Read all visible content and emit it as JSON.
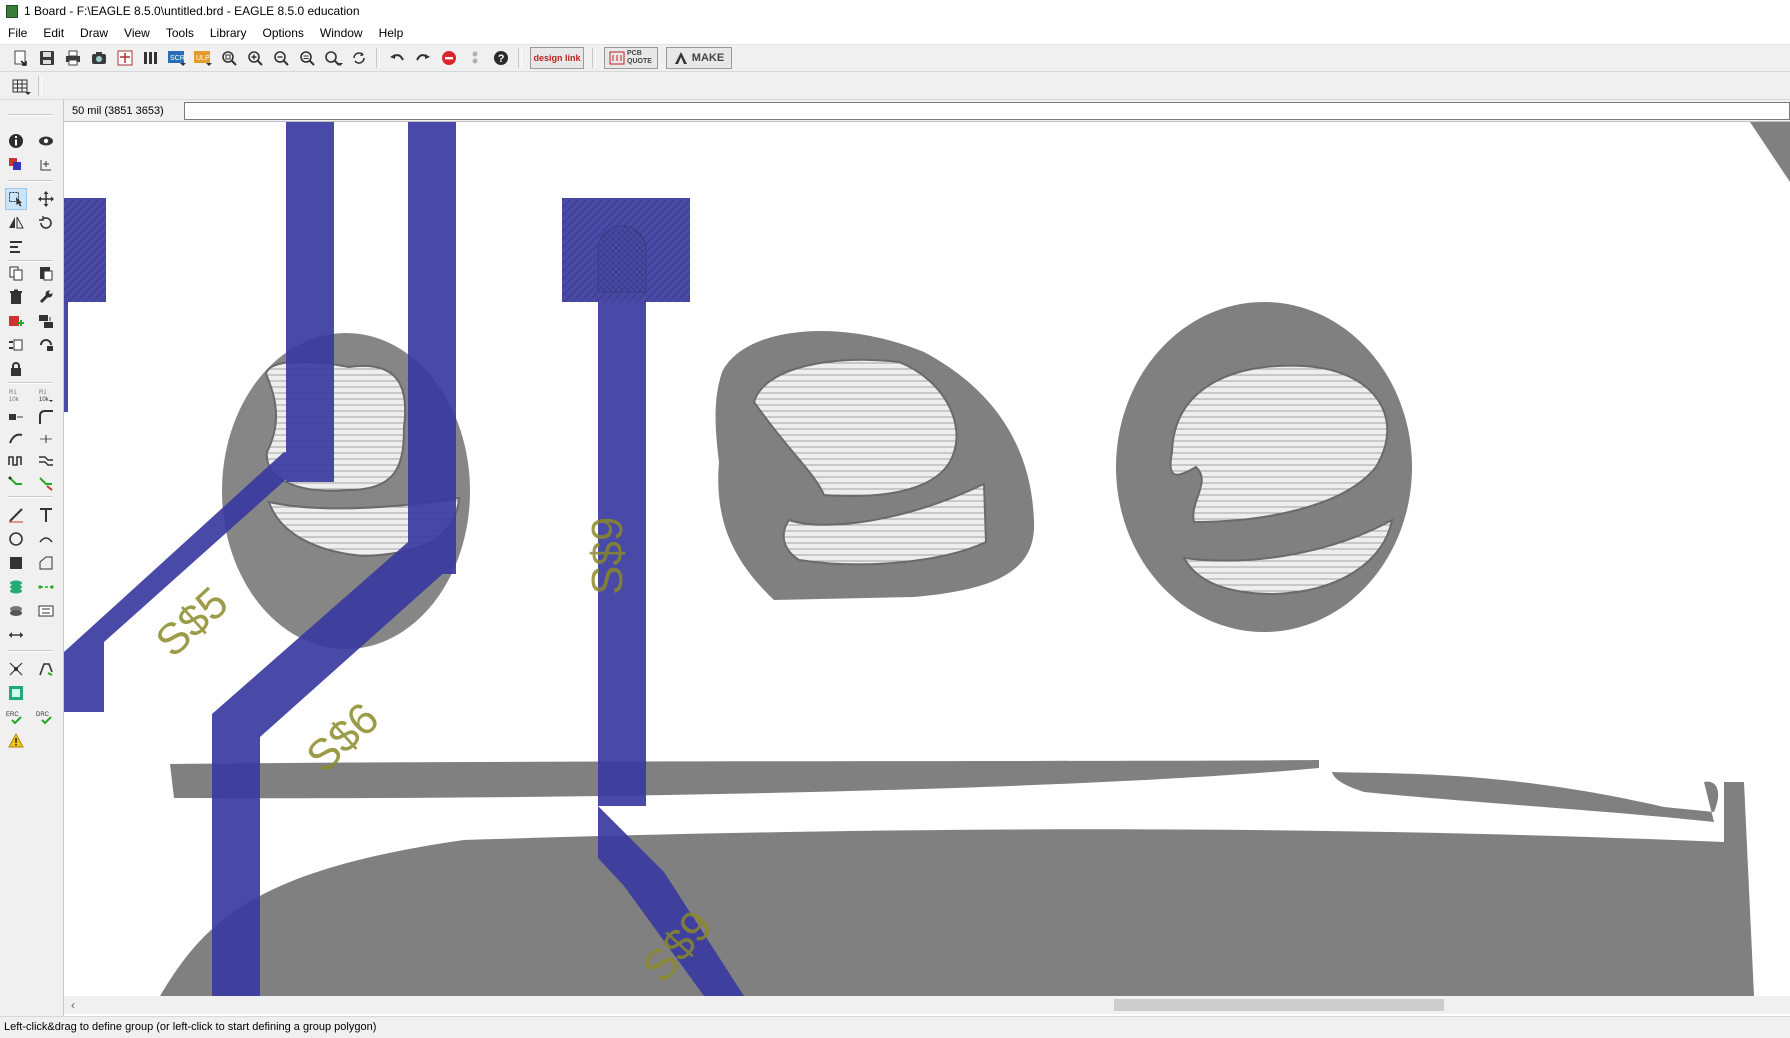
{
  "window": {
    "title": "1 Board - F:\\EAGLE 8.5.0\\untitled.brd - EAGLE 8.5.0 education"
  },
  "menu": [
    "File",
    "Edit",
    "Draw",
    "View",
    "Tools",
    "Library",
    "Options",
    "Window",
    "Help"
  ],
  "toolbar": {
    "scr_label": "SCR",
    "ulp_label": "ULP",
    "design_link_label": "design link",
    "pcb_quote_label": "PCB QUOTE",
    "make_label": "MAKE"
  },
  "coords": {
    "display": "50 mil (3851 3653)"
  },
  "command": {
    "value": ""
  },
  "left_tools": {
    "erc_label": "ERC",
    "drc_label": "DRC"
  },
  "board": {
    "signal_labels": [
      "S$5",
      "S$6",
      "S$9"
    ],
    "colors": {
      "top_layer": "#3a3aa0",
      "copper_pour": "#808080",
      "signal_name": "#8a8a28",
      "background": "#ffffff"
    }
  },
  "status": {
    "text": "Left-click&drag to define group (or left-click to start defining a group polygon)"
  }
}
